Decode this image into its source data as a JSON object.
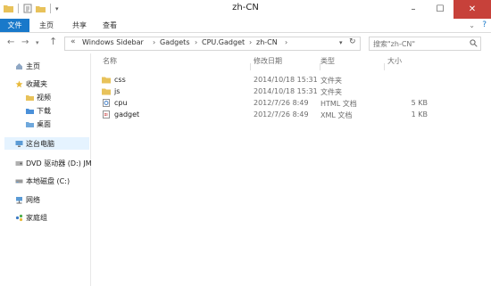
{
  "window": {
    "title": "zh-CN",
    "controls": {
      "minimize": "–",
      "maximize": "☐",
      "close": "✕"
    }
  },
  "ribbon": {
    "tabs": [
      "文件",
      "主页",
      "共享",
      "查看"
    ]
  },
  "address": {
    "segments": [
      "Windows Sidebar",
      "Gadgets",
      "CPU.Gadget",
      "zh-CN"
    ],
    "overflow": "«"
  },
  "search": {
    "placeholder": "搜索\"zh-CN\""
  },
  "nav": {
    "items": [
      {
        "label": "主页",
        "icon": "home-icon"
      },
      {
        "label": "收藏夹",
        "icon": "star-icon"
      },
      {
        "label": "视频",
        "icon": "folder-icon"
      },
      {
        "label": "下载",
        "icon": "folder-icon"
      },
      {
        "label": "桌面",
        "icon": "folder-icon"
      },
      {
        "label": "这台电脑",
        "icon": "computer-icon"
      },
      {
        "label": "DVD 驱动器 (D:) JM",
        "icon": "dvd-icon"
      },
      {
        "label": "本地磁盘 (C:)",
        "icon": "drive-icon"
      },
      {
        "label": "网络",
        "icon": "network-icon"
      },
      {
        "label": "家庭组",
        "icon": "homegroup-icon"
      }
    ]
  },
  "columns": {
    "name": "名称",
    "date": "修改日期",
    "type": "类型",
    "size": "大小"
  },
  "files": [
    {
      "name": "css",
      "date": "2014/10/18 15:31",
      "type": "文件夹",
      "size": "",
      "icon": "folder-icon"
    },
    {
      "name": "js",
      "date": "2014/10/18 15:31",
      "type": "文件夹",
      "size": "",
      "icon": "folder-icon"
    },
    {
      "name": "cpu",
      "date": "2012/7/26 8:49",
      "type": "HTML 文档",
      "size": "5 KB",
      "icon": "html-file-icon"
    },
    {
      "name": "gadget",
      "date": "2012/7/26 8:49",
      "type": "XML 文档",
      "size": "1 KB",
      "icon": "xml-file-icon"
    }
  ],
  "colors": {
    "accent": "#1979ca",
    "close": "#c7413a",
    "folder": "#e8c25a",
    "selected": "#e5f3ff"
  }
}
